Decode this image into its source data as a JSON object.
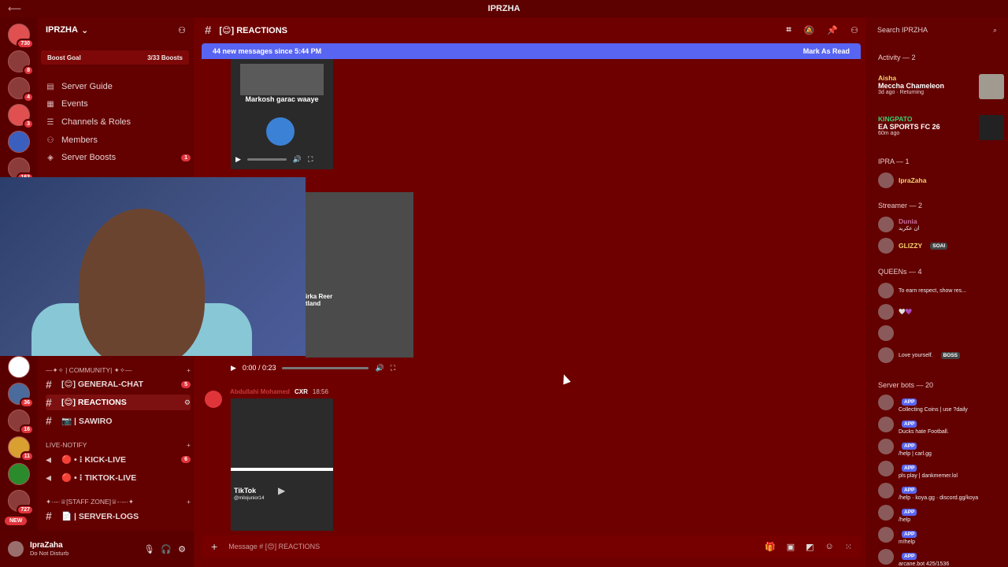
{
  "window": {
    "title": "IPRZHA"
  },
  "server": {
    "name": "IPRZHA"
  },
  "boost": {
    "label": "Boost Goal",
    "progress": "3/33 Boosts"
  },
  "nav": [
    {
      "label": "Server Guide"
    },
    {
      "label": "Events"
    },
    {
      "label": "Channels & Roles"
    },
    {
      "label": "Members"
    },
    {
      "label": "Server Boosts",
      "badge": "1"
    }
  ],
  "server_badges": [
    "730",
    "8",
    "4",
    "3",
    "163",
    "36",
    "16",
    "11",
    "727"
  ],
  "new_badge": "NEW",
  "categories": [
    {
      "label": "—✦✧ | COMMUNITY| ✦✧—"
    },
    {
      "label": "LIVE-NOTIFY"
    },
    {
      "label": "✦·--·♕[STAFF ZONE]♕-·--·✦"
    }
  ],
  "channels": [
    {
      "label": "[😊] GENERAL-CHAT",
      "badge": "5"
    },
    {
      "label": "[😊] REACTIONS"
    },
    {
      "label": "📷 | SAWIRO"
    },
    {
      "label": "🔴 • ⁝ KICK-LIVE",
      "badge": "6"
    },
    {
      "label": "🔴 • ⁝ TIKTOK-LIVE"
    },
    {
      "label": "📄 | SERVER-LOGS"
    }
  ],
  "user": {
    "name": "IpraZaha",
    "status": "Do Not Disturb"
  },
  "chat": {
    "channel": "[😊] REACTIONS",
    "new_messages": "44 new messages since 5:44 PM",
    "mark_read": "Mark As Read",
    "video1_caption": "Markosh garac waaye",
    "video2_time": "0:00 / 0:23",
    "video2_caption": "irka Reer\ntland",
    "author": "Abdullahi Mohamed",
    "author_tag": "CXR",
    "time": "18:56",
    "tiktok_label": "TikTok",
    "tiktok_user": "@milojunior14",
    "placeholder": "Message # [😊] REACTIONS"
  },
  "right": {
    "search_placeholder": "Search IPRZHA",
    "activity_header": "Activity — 2",
    "activities": [
      {
        "name": "Aisha",
        "game": "Meccha Chameleon",
        "meta": "3d ago · Returning"
      },
      {
        "name": "KINGPATO",
        "game": "EA SPORTS FC 26",
        "meta": "60m ago"
      }
    ],
    "sections": [
      {
        "header": "IPRA — 1",
        "members": [
          {
            "name": "IpraZaha",
            "sub": ""
          }
        ]
      },
      {
        "header": "Streamer — 2",
        "members": [
          {
            "name": "Dunia",
            "sub": "ان عكريد"
          },
          {
            "name": "GLIZZY",
            "sub": "SOAI"
          }
        ]
      },
      {
        "header": "QUEENs — 4",
        "members": [
          {
            "name": "",
            "sub": "To earn respect, show res..."
          },
          {
            "name": "",
            "sub": "🤍💜"
          },
          {
            "name": "",
            "sub": ""
          },
          {
            "name": "",
            "sub": "Love yourself.",
            "tag": "BOSS"
          }
        ]
      },
      {
        "header": "Server bots — 20",
        "members": [
          {
            "sub": "Collecting Coins | use ?daily"
          },
          {
            "sub": "Ducks hate Football."
          },
          {
            "sub": "/help | carl.gg"
          },
          {
            "sub": "pls play | dankmemer.lol"
          },
          {
            "sub": "/help · koya.gg · discord.gg/koya"
          },
          {
            "sub": "/help"
          },
          {
            "sub": "m!help"
          },
          {
            "sub": "arcane.bot 425/1536"
          }
        ]
      }
    ],
    "app_tag": "APP"
  }
}
